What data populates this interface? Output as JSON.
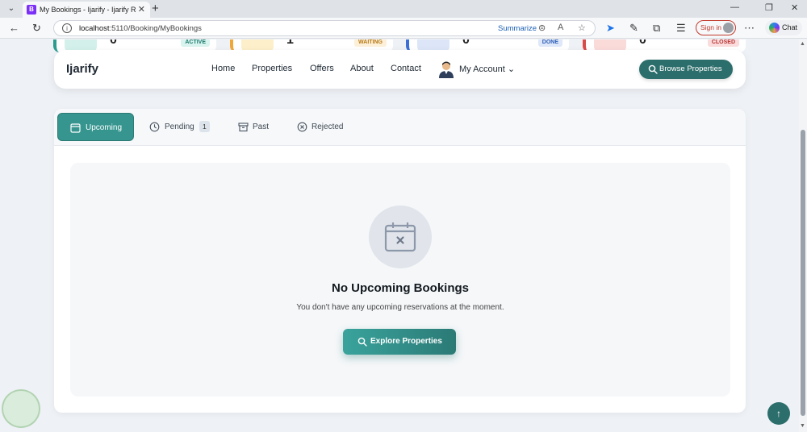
{
  "browser": {
    "tab_title": "My Bookings - Ijarify - Ijarify Real",
    "favicon_letter": "B",
    "url_host": "localhost",
    "url_path": ":5110/Booking/MyBookings",
    "summarize_label": "Summarize",
    "signin_label": "Sign in",
    "chat_label": "Chat"
  },
  "stats": [
    {
      "badge": "ACTIVE",
      "number": "0",
      "color": "#2c9c8f",
      "badge_bg": "#d9f3ee",
      "badge_fg": "#1c7a6e",
      "circle": "#d4f0ea"
    },
    {
      "badge": "WAITING",
      "number": "1",
      "color": "#f0a73a",
      "badge_bg": "#fdf0d9",
      "badge_fg": "#b87a16",
      "circle": "#fdefc9"
    },
    {
      "badge": "DONE",
      "number": "0",
      "color": "#3b6fd6",
      "badge_bg": "#dfe8f8",
      "badge_fg": "#2f5fb8",
      "circle": "#dce6f8"
    },
    {
      "badge": "CLOSED",
      "number": "0",
      "color": "#d94b4b",
      "badge_bg": "#fbdcdc",
      "badge_fg": "#b83232",
      "circle": "#fbdada"
    }
  ],
  "nav": {
    "brand": "Ijarify",
    "links": [
      "Home",
      "Properties",
      "Offers",
      "About",
      "Contact"
    ],
    "account_label": "My Account",
    "browse_label": "Browse Properties"
  },
  "tabs": [
    {
      "label": "Upcoming",
      "icon": "calendar-icon",
      "active": true
    },
    {
      "label": "Pending",
      "icon": "clock-icon",
      "count": "1"
    },
    {
      "label": "Past",
      "icon": "archive-icon"
    },
    {
      "label": "Rejected",
      "icon": "x-circle-icon"
    }
  ],
  "empty_state": {
    "title": "No Upcoming Bookings",
    "message": "You don't have any upcoming reservations at the moment.",
    "button_label": "Explore Properties"
  },
  "colors": {
    "primary": "#2c6e6b",
    "accent": "#36958f"
  }
}
